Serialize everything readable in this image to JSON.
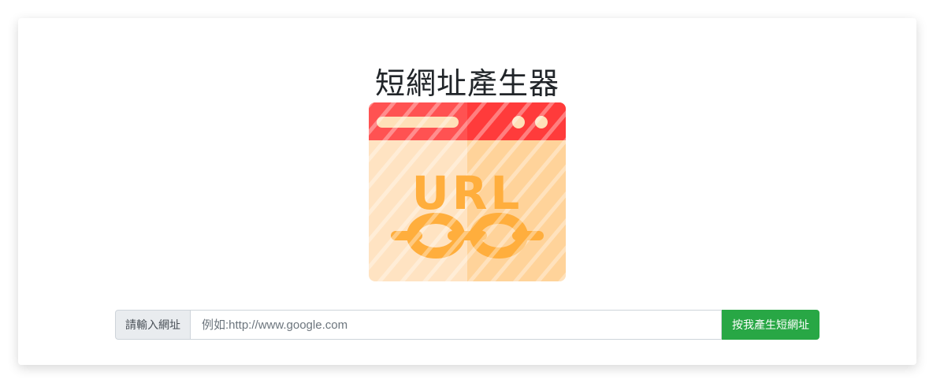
{
  "title": "短網址產生器",
  "illustration": {
    "icon": "url-link-browser-icon",
    "text": "URL",
    "colors": {
      "bar": "#ff4a4a",
      "body": "#ffe0b8",
      "accent": "#ffae3d"
    }
  },
  "form": {
    "prepend_label": "請輸入網址",
    "url_placeholder": "例如:http://www.google.com",
    "url_value": "",
    "submit_label": "按我產生短網址",
    "submit_color": "#28a745"
  }
}
